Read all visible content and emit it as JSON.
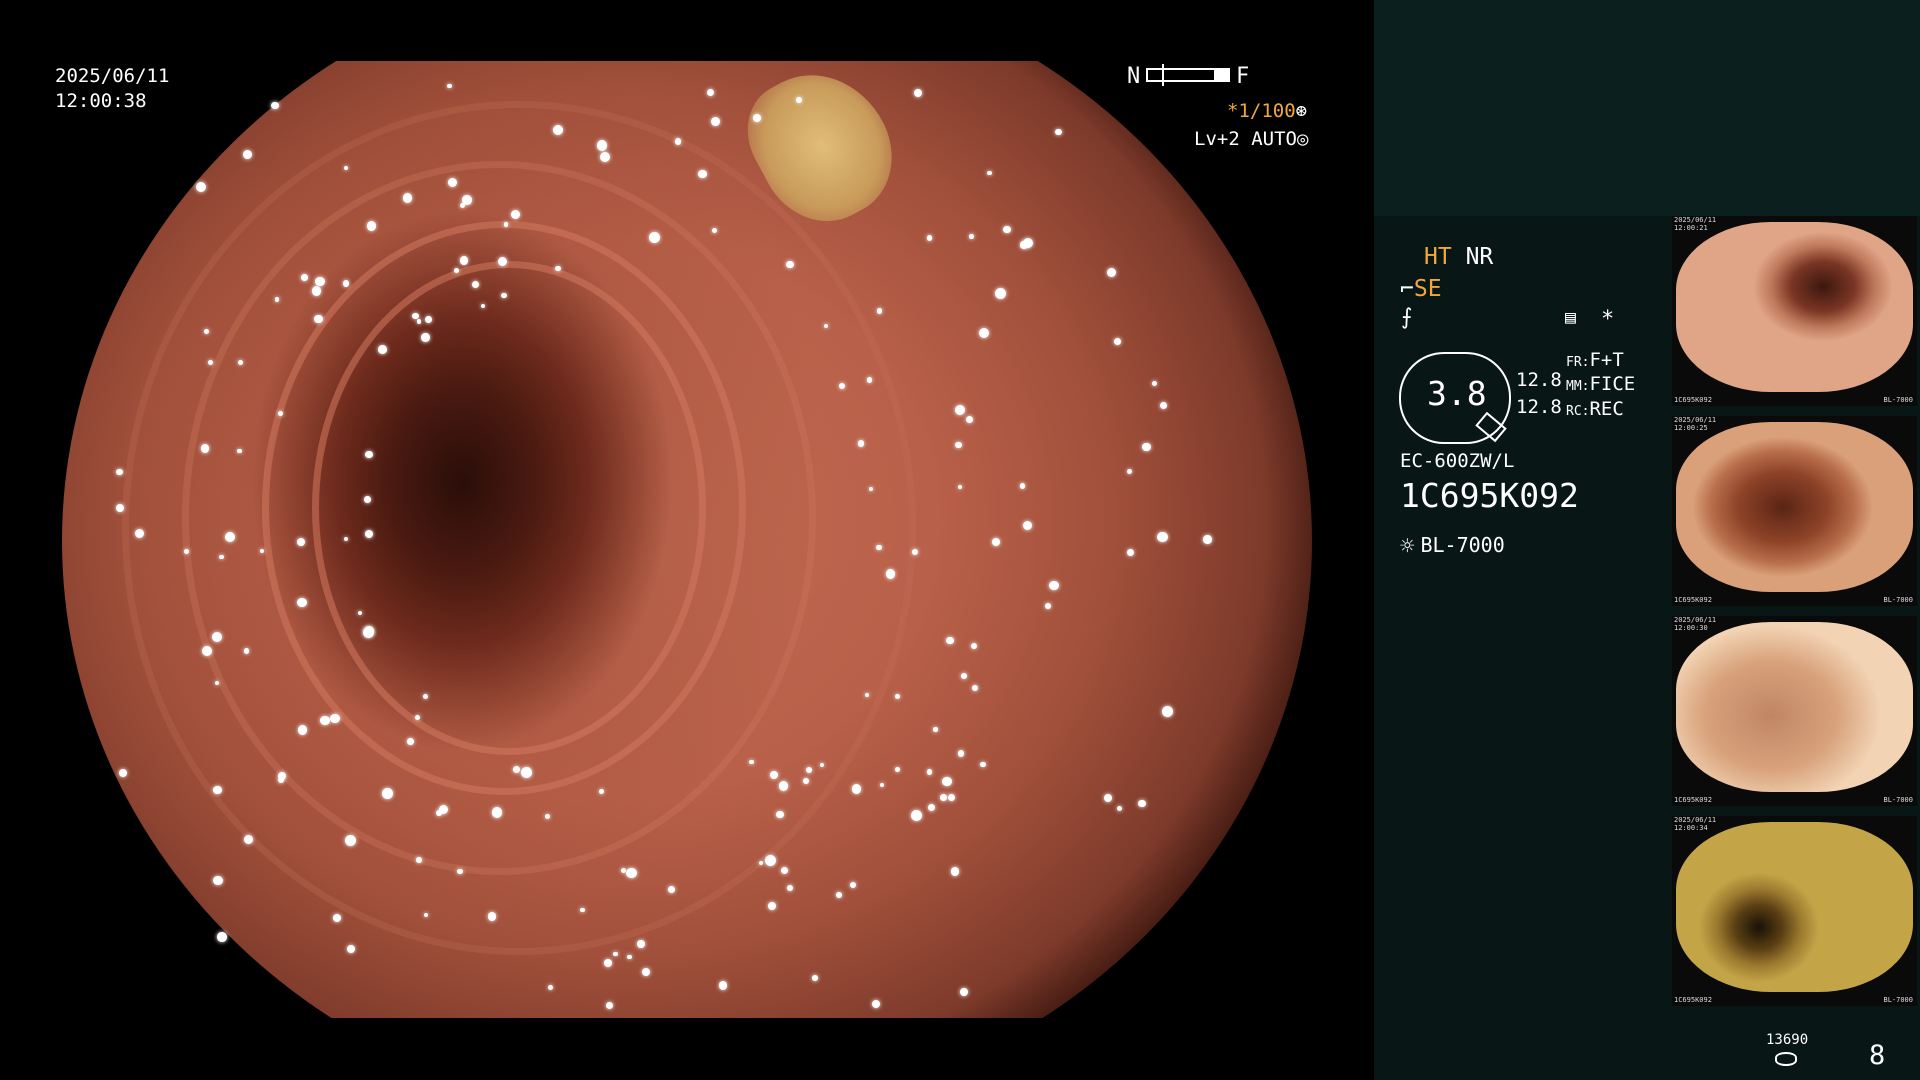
{
  "overlay": {
    "date": "2025/06/11",
    "time": "12:00:38",
    "scale_near": "N",
    "scale_far": "F",
    "shutter": "1/100",
    "shutter_prefix": "*",
    "level": "Lv+2 AUTO"
  },
  "panel": {
    "ht_label": "HT",
    "nr_label": "NR",
    "se_label": "SE",
    "star": "*",
    "gauge_value": "3.8",
    "zoom_1": "12.8",
    "zoom_2": "12.8",
    "fr_key": "FR:",
    "fr_value": "F+T",
    "mm_key": "MM:",
    "mm_value": "FICE",
    "rc_key": "RC:",
    "rc_value": "REC",
    "scope_model": "EC-600ZW/L",
    "serial": "1C695K092",
    "light_source": "BL-7000",
    "image_count": "13690",
    "page": "8"
  },
  "thumbnails": [
    {
      "caption_date": "2025/06/11",
      "caption_time": "12:00:21",
      "serial": "1C695K092",
      "status": "BL-7000"
    },
    {
      "caption_date": "2025/06/11",
      "caption_time": "12:00:25",
      "serial": "1C695K092",
      "status": "BL-7000"
    },
    {
      "caption_date": "2025/06/11",
      "caption_time": "12:00:30",
      "serial": "1C695K092",
      "status": "BL-7000"
    },
    {
      "caption_date": "2025/06/11",
      "caption_time": "12:00:34",
      "serial": "1C695K092",
      "status": "BL-7000"
    }
  ],
  "icons": {
    "shutter": "shutter-icon",
    "level": "brightness-mode-icon",
    "light": "light-source-icon",
    "memo": "memo-icon",
    "storage": "storage-icon"
  }
}
